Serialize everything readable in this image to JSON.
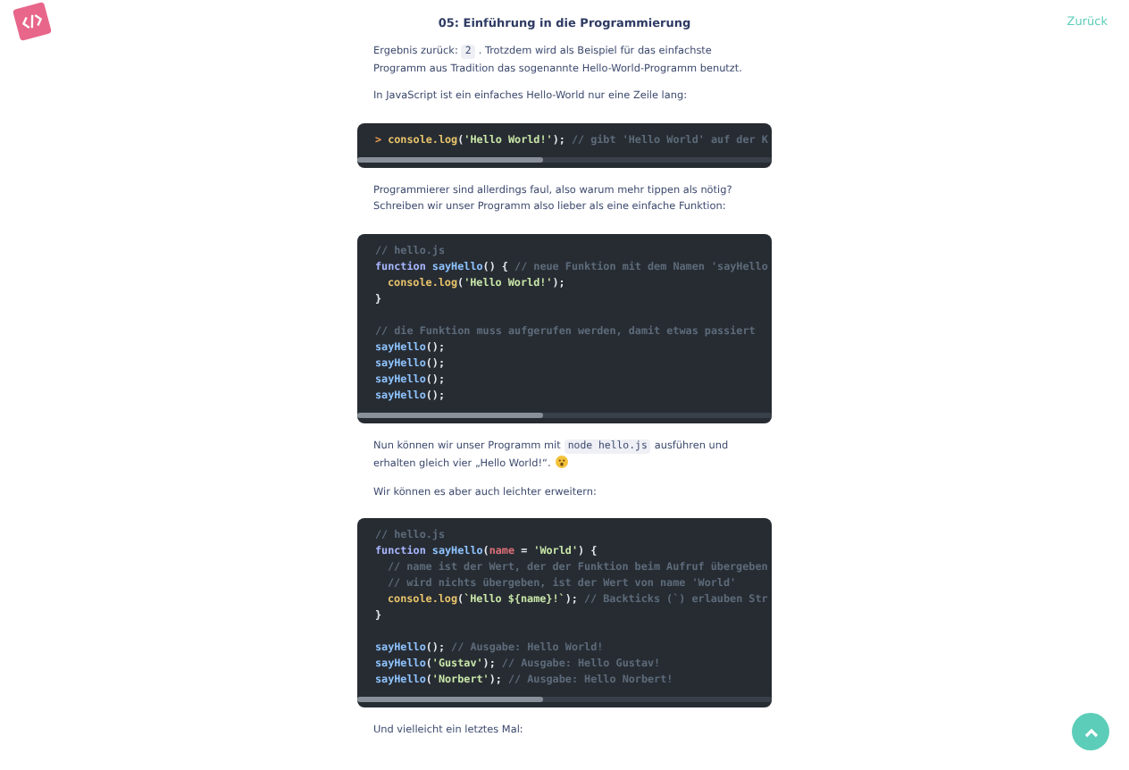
{
  "header": {
    "title": "05: Einführung in die Programmierung",
    "back_link": "Zurück"
  },
  "content": [
    {
      "kind": "para",
      "parts": [
        {
          "kind": "text",
          "text": "Ergebnis zurück:"
        },
        {
          "kind": "code",
          "text": "2"
        },
        {
          "kind": "text",
          "text": ". Trotzdem wird als Beispiel für das einfachste Programm aus Tradition das sogenannte Hello-World-Programm benutzt."
        }
      ]
    },
    {
      "kind": "para",
      "parts": [
        {
          "kind": "text",
          "text": "In JavaScript ist ein einfaches Hello-World nur eine Zeile lang:"
        }
      ]
    },
    {
      "kind": "code_block",
      "lines": [
        {
          "kind": "code",
          "indented": false,
          "tokens": [
            {
              "kind": "prompt",
              "text": ">"
            },
            {
              "kind": "call",
              "text": " console.log"
            },
            {
              "kind": "plain",
              "text": "("
            },
            {
              "kind": "str",
              "text": "'Hello World!'"
            },
            {
              "kind": "plain",
              "text": ");"
            },
            {
              "kind": "cm",
              "text": " // gibt 'Hello World' auf der K"
            }
          ]
        }
      ]
    },
    {
      "kind": "para",
      "parts": [
        {
          "kind": "text",
          "text": "Programmierer sind allerdings faul, also warum mehr tippen als nötig? Schreiben wir unser Programm also lieber als eine einfache Funktion:"
        }
      ]
    },
    {
      "kind": "code_block",
      "lines": [
        {
          "kind": "code",
          "indented": false,
          "tokens": [
            {
              "kind": "cm",
              "text": "// hello.js"
            }
          ]
        },
        {
          "kind": "code",
          "indented": false,
          "tokens": [
            {
              "kind": "kw",
              "text": "function"
            },
            {
              "kind": "fn",
              "text": " sayHello"
            },
            {
              "kind": "plain",
              "text": "() {"
            },
            {
              "kind": "cm",
              "text": " // neue Funktion mit dem Namen 'sayHello"
            }
          ]
        },
        {
          "kind": "code",
          "indented": true,
          "tokens": [
            {
              "kind": "call",
              "text": "console.log"
            },
            {
              "kind": "plain",
              "text": "("
            },
            {
              "kind": "str",
              "text": "'Hello World!'"
            },
            {
              "kind": "plain",
              "text": ");"
            }
          ]
        },
        {
          "kind": "code",
          "indented": false,
          "tokens": [
            {
              "kind": "plain",
              "text": "}"
            }
          ]
        },
        {
          "kind": "blank"
        },
        {
          "kind": "code",
          "indented": false,
          "tokens": [
            {
              "kind": "cm",
              "text": "// die Funktion muss aufgerufen werden, damit etwas passiert"
            }
          ]
        },
        {
          "kind": "code",
          "indented": false,
          "tokens": [
            {
              "kind": "fn",
              "text": "sayHello"
            },
            {
              "kind": "plain",
              "text": "();"
            }
          ]
        },
        {
          "kind": "code",
          "indented": false,
          "tokens": [
            {
              "kind": "fn",
              "text": "sayHello"
            },
            {
              "kind": "plain",
              "text": "();"
            }
          ]
        },
        {
          "kind": "code",
          "indented": false,
          "tokens": [
            {
              "kind": "fn",
              "text": "sayHello"
            },
            {
              "kind": "plain",
              "text": "();"
            }
          ]
        },
        {
          "kind": "code",
          "indented": false,
          "tokens": [
            {
              "kind": "fn",
              "text": "sayHello"
            },
            {
              "kind": "plain",
              "text": "();"
            }
          ]
        }
      ]
    },
    {
      "kind": "para",
      "parts": [
        {
          "kind": "text",
          "text": "Nun können wir unser Programm mit"
        },
        {
          "kind": "code",
          "text": "node hello.js"
        },
        {
          "kind": "text",
          "text": "ausführen und erhalten gleich vier „Hello World!“."
        },
        {
          "kind": "emoji"
        }
      ]
    },
    {
      "kind": "para",
      "parts": [
        {
          "kind": "text",
          "text": "Wir können es aber auch leichter erweitern:"
        }
      ]
    },
    {
      "kind": "code_block",
      "lines": [
        {
          "kind": "code",
          "indented": false,
          "tokens": [
            {
              "kind": "cm",
              "text": "// hello.js"
            }
          ]
        },
        {
          "kind": "code",
          "indented": false,
          "tokens": [
            {
              "kind": "kw",
              "text": "function"
            },
            {
              "kind": "fn",
              "text": " sayHello"
            },
            {
              "kind": "plain",
              "text": "("
            },
            {
              "kind": "var",
              "text": "name"
            },
            {
              "kind": "plain",
              "text": " = "
            },
            {
              "kind": "str",
              "text": "'World'"
            },
            {
              "kind": "plain",
              "text": ") {"
            }
          ]
        },
        {
          "kind": "code",
          "indented": true,
          "tokens": [
            {
              "kind": "cm",
              "text": "// name ist der Wert, der der Funktion beim Aufruf übergeben"
            }
          ]
        },
        {
          "kind": "code",
          "indented": true,
          "tokens": [
            {
              "kind": "cm",
              "text": "// wird nichts übergeben, ist der Wert von name 'World'"
            }
          ]
        },
        {
          "kind": "code",
          "indented": true,
          "tokens": [
            {
              "kind": "call",
              "text": "console.log"
            },
            {
              "kind": "plain",
              "text": "("
            },
            {
              "kind": "str",
              "text": "`Hello ${name}!`"
            },
            {
              "kind": "plain",
              "text": ");"
            },
            {
              "kind": "cm",
              "text": " // Backticks (`) erlauben Str"
            }
          ]
        },
        {
          "kind": "code",
          "indented": false,
          "tokens": [
            {
              "kind": "plain",
              "text": "}"
            }
          ]
        },
        {
          "kind": "blank"
        },
        {
          "kind": "code",
          "indented": false,
          "tokens": [
            {
              "kind": "fn",
              "text": "sayHello"
            },
            {
              "kind": "plain",
              "text": "();"
            },
            {
              "kind": "cm",
              "text": " // Ausgabe: Hello World!"
            }
          ]
        },
        {
          "kind": "code",
          "indented": false,
          "tokens": [
            {
              "kind": "fn",
              "text": "sayHello"
            },
            {
              "kind": "plain",
              "text": "("
            },
            {
              "kind": "str",
              "text": "'Gustav'"
            },
            {
              "kind": "plain",
              "text": ");"
            },
            {
              "kind": "cm",
              "text": " // Ausgabe: Hello Gustav!"
            }
          ]
        },
        {
          "kind": "code",
          "indented": false,
          "tokens": [
            {
              "kind": "fn",
              "text": "sayHello"
            },
            {
              "kind": "plain",
              "text": "("
            },
            {
              "kind": "str",
              "text": "'Norbert'"
            },
            {
              "kind": "plain",
              "text": ");"
            },
            {
              "kind": "cm",
              "text": " // Ausgabe: Hello Norbert!"
            }
          ]
        }
      ]
    },
    {
      "kind": "para",
      "parts": [
        {
          "kind": "text",
          "text": "Und vielleicht ein letztes Mal:"
        }
      ]
    }
  ]
}
